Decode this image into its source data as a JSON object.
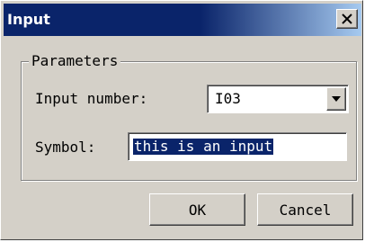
{
  "window": {
    "title": "Input",
    "close_label": "X"
  },
  "parameters": {
    "group_label": "Parameters",
    "input_number_label": "Input number:",
    "input_number_value": "I03",
    "symbol_label": "Symbol:",
    "symbol_value": "this is an input"
  },
  "buttons": {
    "ok_label": "OK",
    "cancel_label": "Cancel"
  },
  "colors": {
    "title_bar": "#0a246a",
    "title_bar_fade": "#a6caf0",
    "dialog_face": "#d4d0c8",
    "selection_bg": "#0a246a",
    "selection_text": "#ffffff"
  },
  "icons": {
    "close": "close-icon",
    "dropdown": "chevron-down-icon"
  }
}
